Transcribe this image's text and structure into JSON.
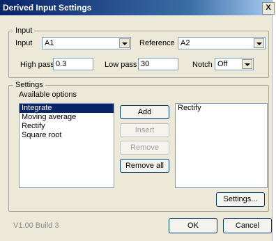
{
  "window": {
    "title": "Derived Input Settings",
    "close_glyph": "X"
  },
  "input_group": {
    "legend": "Input",
    "input_label": "Input",
    "input_value": "A1",
    "reference_label": "Reference",
    "reference_value": "A2",
    "highpass_label": "High pass",
    "highpass_value": "0.3",
    "lowpass_label": "Low pass",
    "lowpass_value": "30",
    "notch_label": "Notch",
    "notch_value": "Off"
  },
  "settings_group": {
    "legend": "Settings",
    "available_label": "Available options",
    "available_options": [
      "Integrate",
      "Moving average",
      "Rectify",
      "Square root"
    ],
    "selected_index": 0,
    "selected_options": [
      "Rectify"
    ],
    "add_label": "Add",
    "insert_label": "Insert",
    "remove_label": "Remove",
    "remove_all_label": "Remove all",
    "settings_label": "Settings..."
  },
  "footer": {
    "version": "V1.00 Build 3",
    "ok_label": "OK",
    "cancel_label": "Cancel"
  },
  "colors": {
    "dialog_bg": "#ece9d8",
    "selection": "#0a246a",
    "titlebar": "#0a246a"
  }
}
